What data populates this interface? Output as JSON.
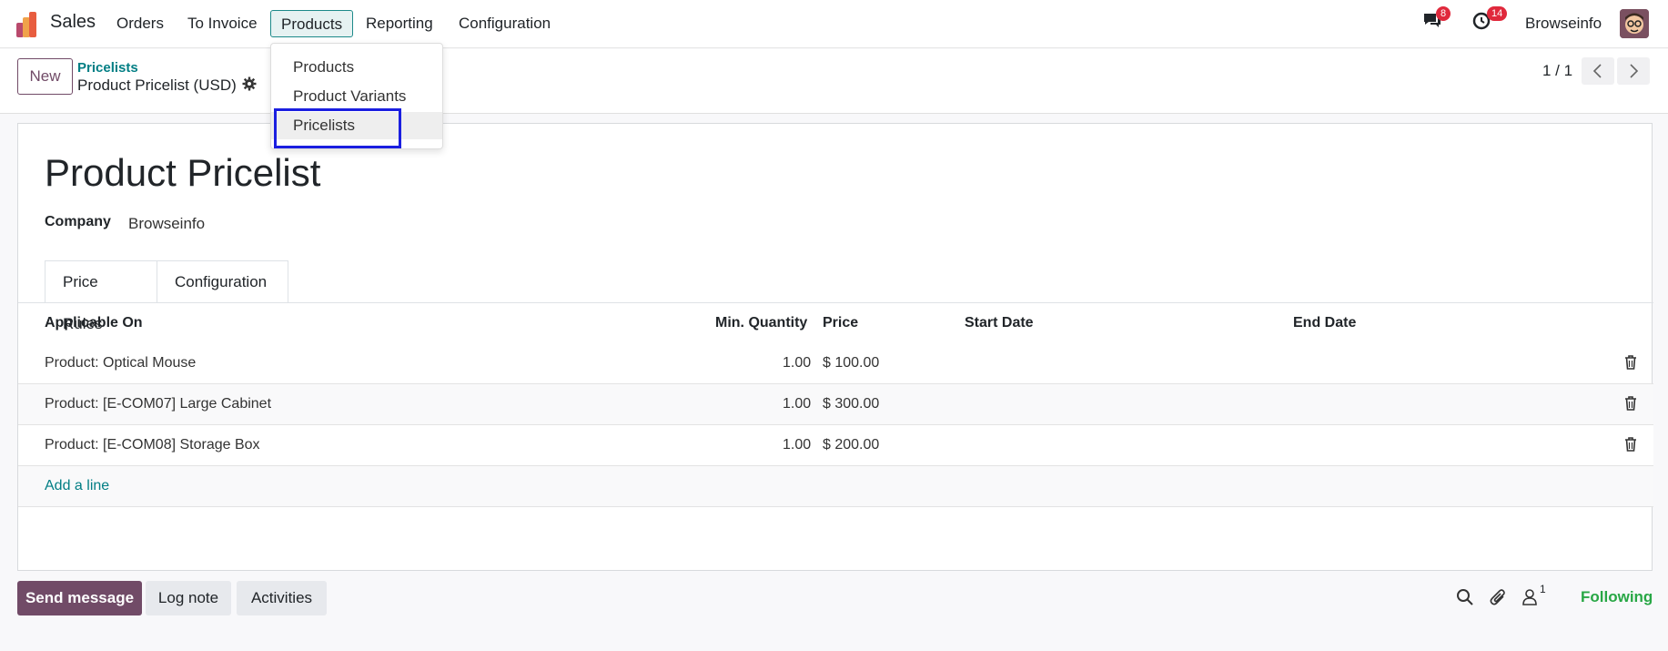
{
  "nav": {
    "app_name": "Sales",
    "menu": [
      "Orders",
      "To Invoice",
      "Products",
      "Reporting",
      "Configuration"
    ],
    "messages_badge": "8",
    "activities_badge": "14",
    "user_name": "Browseinfo"
  },
  "products_menu": {
    "items": [
      "Products",
      "Product Variants",
      "Pricelists"
    ],
    "highlighted": "Pricelists"
  },
  "control_panel": {
    "new_label": "New",
    "breadcrumb": "Pricelists",
    "record_name": "Product Pricelist (USD)",
    "pager": "1 / 1"
  },
  "form": {
    "title": "Product Pricelist",
    "company_label": "Company",
    "company_value": "Browseinfo",
    "tabs": [
      "Price Rules",
      "Configuration"
    ],
    "columns": [
      "Applicable On",
      "Min. Quantity",
      "Price",
      "Start Date",
      "End Date"
    ],
    "rows": [
      {
        "applicable": "Product: Optical Mouse",
        "min_qty": "1.00",
        "price": "$ 100.00",
        "start": "",
        "end": ""
      },
      {
        "applicable": "Product: [E-COM07] Large Cabinet",
        "min_qty": "1.00",
        "price": "$ 300.00",
        "start": "",
        "end": ""
      },
      {
        "applicable": "Product: [E-COM08] Storage Box",
        "min_qty": "1.00",
        "price": "$ 200.00",
        "start": "",
        "end": ""
      }
    ],
    "add_line": "Add a line"
  },
  "chatter": {
    "send_message": "Send message",
    "log_note": "Log note",
    "activities": "Activities",
    "followers_count": "1",
    "following": "Following"
  },
  "colors": {
    "brand": "#714b67",
    "link": "#017e84",
    "badge": "#e0293c",
    "highlight": "#1b1fe0",
    "following": "#28a745"
  },
  "icons": [
    "sales-app-icon",
    "chat-icon",
    "clock-icon",
    "gear-icon",
    "chevron-left-icon",
    "chevron-right-icon",
    "trash-icon",
    "search-icon",
    "paperclip-icon",
    "user-icon"
  ]
}
